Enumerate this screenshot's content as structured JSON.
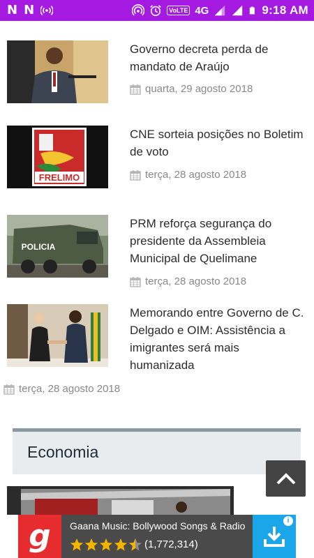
{
  "status_bar": {
    "left_icons": [
      "netflix-n-icon",
      "netflix-n-icon",
      "wireless-broadcast-icon"
    ],
    "network": "4G",
    "volte": "VoLTE",
    "time": "9:18 AM",
    "color": "#a41ae0"
  },
  "articles": [
    {
      "title": "Governo decreta perda de mandato de Araújo",
      "date": "quarta, 29 agosto 2018",
      "thumb": "man-speaking-at-podium"
    },
    {
      "title": "CNE sorteia posições no Boletim de voto",
      "date": "terça, 28 agosto 2018",
      "thumb": "frelimo-logo",
      "thumb_text": "FRELIMO"
    },
    {
      "title": "PRM reforça segurança do presidente da Assembleia Municipal de Quelimane",
      "date": "terça, 28 agosto 2018",
      "thumb": "police-armored-vehicle",
      "thumb_text": "POLICIA"
    },
    {
      "title": "Memorando entre Governo de C. Delgado e OIM: Assistência a imigrantes será mais humanizada",
      "date": "terça, 28 agosto 2018",
      "thumb": "handshake-ceremony"
    }
  ],
  "section": {
    "title": "Economia"
  },
  "ad": {
    "title": "Gaana Music: Bollywood Songs & Radio",
    "rating_count": "(1,772,314)",
    "stars": 4.5,
    "brand_color": "#e72c30"
  }
}
